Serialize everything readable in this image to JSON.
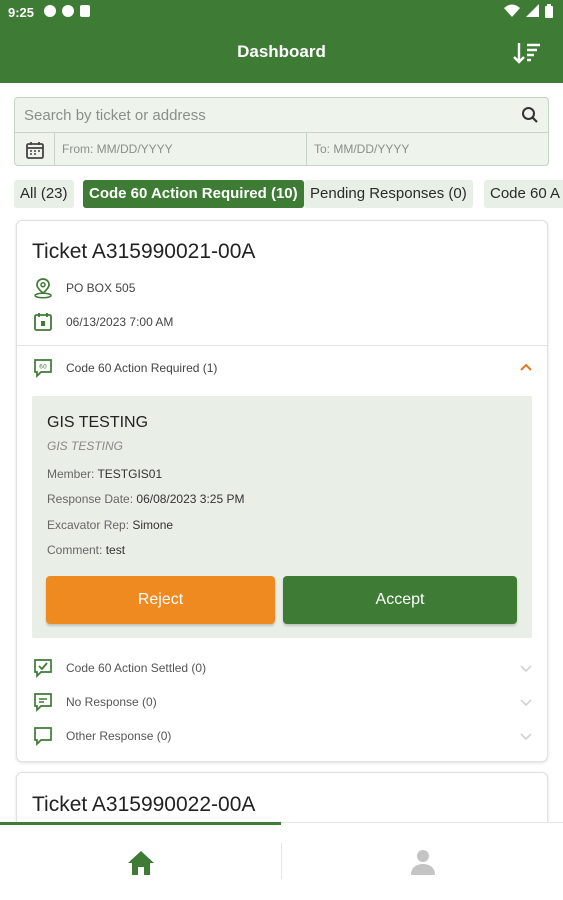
{
  "status_bar": {
    "time": "9:25"
  },
  "header": {
    "title": "Dashboard",
    "sort_icon": "sort-icon"
  },
  "search": {
    "placeholder": "Search by ticket or address",
    "from_placeholder": "From: MM/DD/YYYY",
    "to_placeholder": "To: MM/DD/YYYY"
  },
  "filters": [
    {
      "label": "All (23)",
      "active": false
    },
    {
      "label": "Code 60 Action Required (10)",
      "active": true
    },
    {
      "label": "Pending Responses (0)",
      "active": false
    },
    {
      "label": "Code 60 A",
      "active": false
    }
  ],
  "ticket1": {
    "title": "Ticket A315990021-00A",
    "address": "PO BOX 505",
    "date": "06/13/2023 7:00 AM",
    "section_open": "Code 60 Action Required (1)",
    "response": {
      "title": "GIS TESTING",
      "subtitle": "GIS TESTING",
      "member_label": "Member: ",
      "member": "TESTGIS01",
      "response_date_label": "Response Date: ",
      "response_date": "06/08/2023 3:25 PM",
      "rep_label": "Excavator Rep: ",
      "rep": "Simone",
      "comment_label": "Comment: ",
      "comment": "test",
      "reject_label": "Reject",
      "accept_label": "Accept"
    },
    "sections": [
      "Code 60 Action Settled (0)",
      "No Response (0)",
      "Other Response (0)"
    ]
  },
  "ticket2": {
    "title": "Ticket A315990022-00A"
  },
  "colors": {
    "primary": "#3e7b34",
    "reject": "#ef8a20",
    "accent": "#e27a20"
  }
}
